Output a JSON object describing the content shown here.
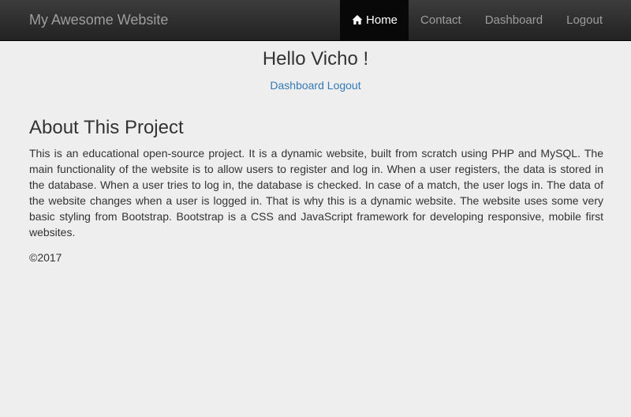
{
  "navbar": {
    "brand": "My Awesome Website",
    "items": [
      {
        "label": "Home",
        "icon": "home-icon",
        "active": true
      },
      {
        "label": "Contact"
      },
      {
        "label": "Dashboard"
      },
      {
        "label": "Logout"
      }
    ]
  },
  "main": {
    "greeting": "Hello Vicho !",
    "links": [
      {
        "label": "Dashboard"
      },
      {
        "label": "Logout"
      }
    ],
    "about_title": "About This Project",
    "about_text": "This is an educational open-source project. It is a dynamic website, built from scratch using PHP and MySQL. The main functionality of the website is to allow users to register and log in. When a user registers, the data is stored in the database. When a user tries to log in, the database is checked. In case of a match, the user logs in. The data of the website changes when a user is logged in. That is why this is a dynamic website. The website uses some very basic styling from Bootstrap. Bootstrap is a CSS and JavaScript framework for developing responsive, mobile first websites.",
    "copyright": "©2017"
  },
  "colors": {
    "background": "#eeeeee",
    "navbar": "#222222",
    "link": "#337ab7",
    "text": "#333333"
  }
}
